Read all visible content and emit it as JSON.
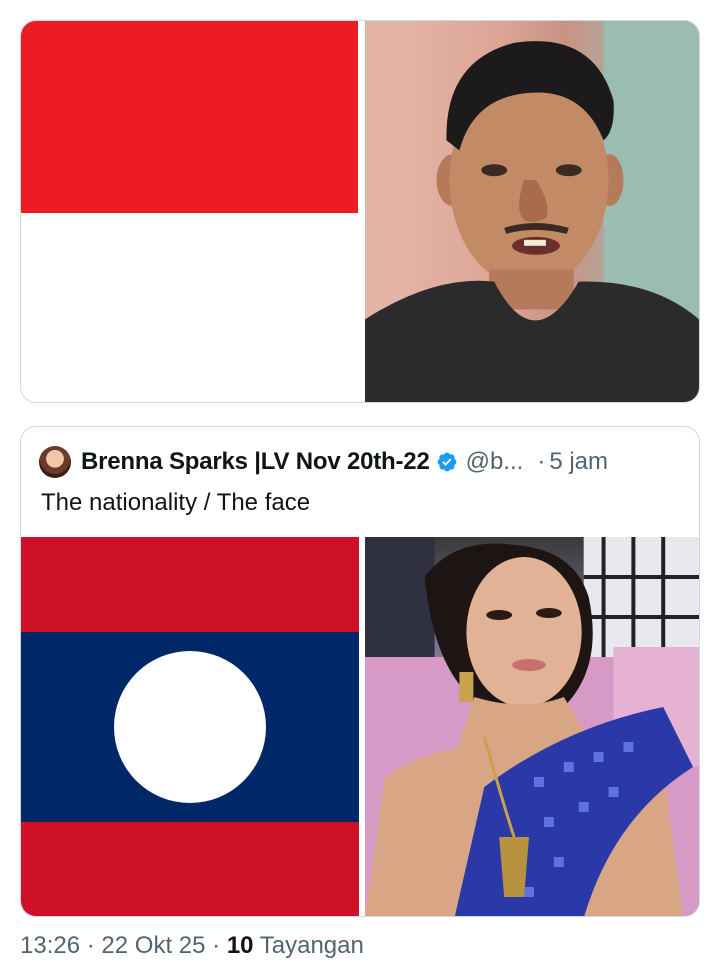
{
  "top_media": {
    "left_image": "indonesia-flag",
    "right_image": "man-portrait-photo"
  },
  "quote": {
    "author_name": "Brenna Sparks |LV Nov 20th-22",
    "handle": "@b...",
    "separator": "·",
    "time": "5 jam",
    "verified_icon": "verified-badge-icon",
    "text": "The nationality / The face",
    "left_image": "laos-flag",
    "right_image": "woman-portrait-photo"
  },
  "meta": {
    "time": "13:26",
    "sep1": "·",
    "date": "22 Okt 25",
    "sep2": "·",
    "views_count": "10",
    "views_label": "Tayangan"
  },
  "colors": {
    "indonesia_red": "#ed1c24",
    "laos_red": "#ce1126",
    "laos_blue": "#002868",
    "verified_blue": "#1d9bf0",
    "secondary_text": "#536471",
    "border": "#cfd9de"
  }
}
